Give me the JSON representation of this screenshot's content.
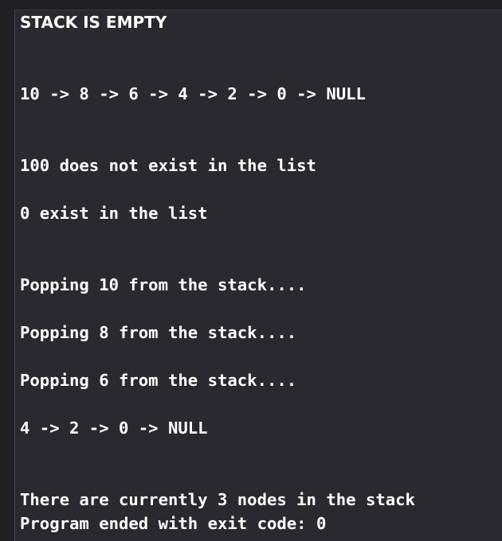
{
  "console": {
    "lines": [
      "STACK IS EMPTY",
      "10 -> 8 -> 6 -> 4 -> 2 -> 0 -> NULL",
      "100 does not exist in the list",
      "0 exist in the list",
      "Popping 10 from the stack....",
      "Popping 8 from the stack....",
      "Popping 6 from the stack....",
      "4 -> 2 -> 0 -> NULL",
      "There are currently 3 nodes in the stack",
      "Program ended with exit code: 0"
    ]
  },
  "colors": {
    "background": "#29292f",
    "text": "#ffffff",
    "gutter": "#202025"
  }
}
